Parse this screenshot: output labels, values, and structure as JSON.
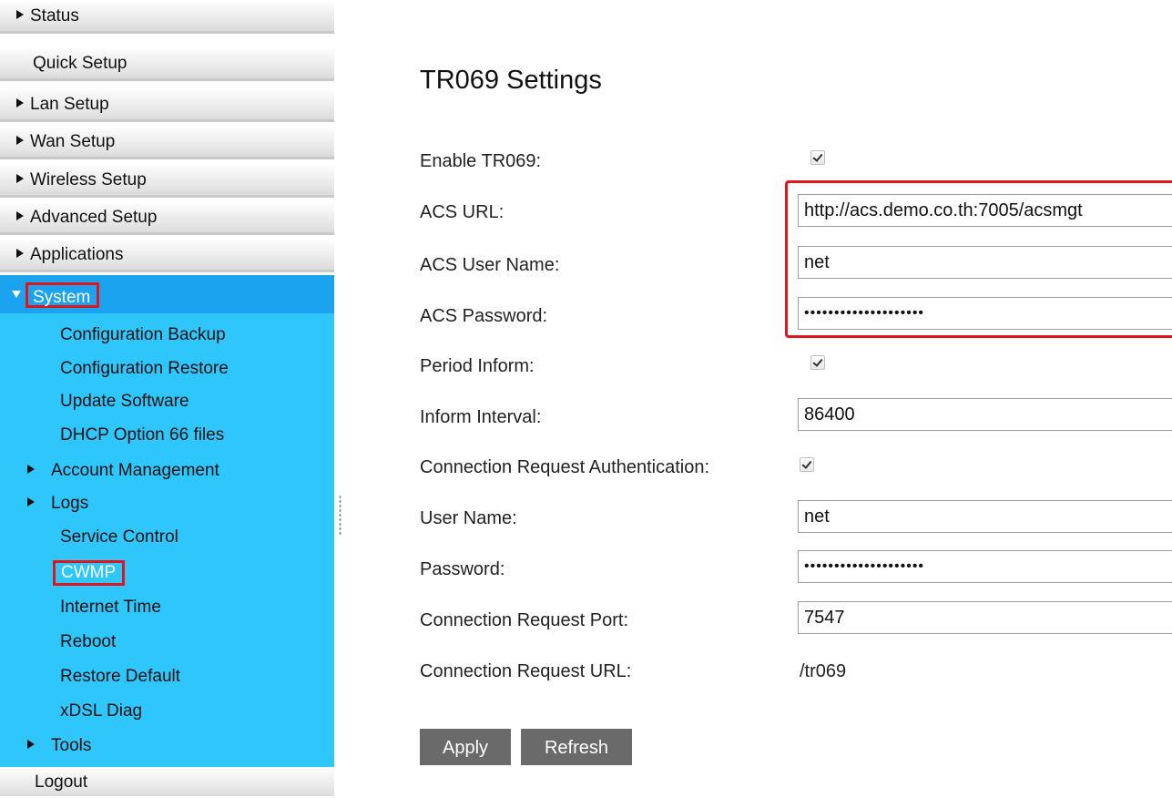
{
  "sidebar": {
    "top_items": [
      {
        "label": "Status",
        "arrow": true
      },
      {
        "label": "Quick Setup",
        "arrow": false
      },
      {
        "label": "Lan Setup",
        "arrow": true
      },
      {
        "label": "Wan Setup",
        "arrow": true
      },
      {
        "label": "Wireless Setup",
        "arrow": true
      },
      {
        "label": "Advanced Setup",
        "arrow": true
      },
      {
        "label": "Applications",
        "arrow": true
      }
    ],
    "system": {
      "label": "System",
      "items": [
        {
          "label": "Configuration Backup"
        },
        {
          "label": "Configuration Restore"
        },
        {
          "label": "Update Software"
        },
        {
          "label": "DHCP Option 66 files"
        },
        {
          "label": "Account Management"
        },
        {
          "label": "Logs"
        },
        {
          "label": "Service Control"
        },
        {
          "label": "CWMP"
        },
        {
          "label": "Internet Time"
        },
        {
          "label": "Reboot"
        },
        {
          "label": "Restore Default"
        },
        {
          "label": "xDSL Diag"
        },
        {
          "label": "Tools"
        }
      ]
    },
    "logout_label": "Logout"
  },
  "page_title": "TR069 Settings",
  "form": {
    "enable_tr069": {
      "label": "Enable TR069:",
      "checked": true
    },
    "acs_url": {
      "label": "ACS URL:",
      "value": "http://acs.demo.co.th:7005/acsmgt"
    },
    "acs_user_name": {
      "label": "ACS User Name:",
      "value": "net"
    },
    "acs_password": {
      "label": "ACS Password:",
      "value": "••••••••••••••••••••"
    },
    "period_inform": {
      "label": "Period Inform:",
      "checked": true
    },
    "inform_interval": {
      "label": "Inform Interval:",
      "value": "86400"
    },
    "conn_req_auth": {
      "label": "Connection Request Authentication:",
      "checked": true
    },
    "user_name": {
      "label": "User Name:",
      "value": "net"
    },
    "password": {
      "label": "Password:",
      "value": "••••••••••••••••••••"
    },
    "conn_req_port": {
      "label": "Connection Request Port:",
      "value": "7547"
    },
    "conn_req_url": {
      "label": "Connection Request URL:",
      "value": "/tr069"
    }
  },
  "buttons": {
    "apply": "Apply",
    "refresh": "Refresh"
  },
  "colors": {
    "highlight": "#e0161d",
    "system_bg": "#2ec6fb",
    "system_header": "#1ba3f0",
    "button_bg": "#6a6a6a"
  }
}
